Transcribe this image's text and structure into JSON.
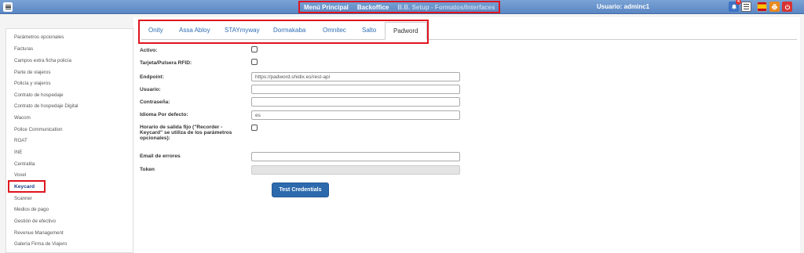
{
  "topbar": {
    "nav": [
      "Menú Principal",
      "Backoffice",
      "B.B. Setup - Formatos/Interfaces"
    ],
    "user": "Usuario: adminc1",
    "notification_count": "4",
    "icons": [
      "menu-icon",
      "bell-icon",
      "document-icon",
      "spain-flag-icon",
      "print-icon",
      "power-icon"
    ]
  },
  "sidebar": {
    "items": [
      "Parámetros opcionales",
      "Facturas",
      "Campos extra ficha policía",
      "Parte de viajeros",
      "Policía y viajeros",
      "Contrato de hospedaje",
      "Contrato de hospedaje Digital",
      "Wacom",
      "Police Communication",
      "ROAT",
      "INE",
      "Centralita",
      "Voxel",
      "Keycard",
      "Scanner",
      "Medios de pago",
      "Gestión de efectivo",
      "Revenue Management",
      "Galería Firma de Viajero"
    ],
    "active_item": "Keycard"
  },
  "tabs": [
    "Onity",
    "Assa Abloy",
    "STAYmyway",
    "Dormakaba",
    "Omnitec",
    "Salto",
    "Padword"
  ],
  "active_tab": "Padword",
  "form": {
    "activo_label": "Activo:",
    "tarjeta_label": "Tarjeta/Pulsera RFID:",
    "endpoint_label": "Endpoint:",
    "endpoint_value": "https://padword.shidix.es/rest-api",
    "usuario_label": "Usuario:",
    "usuario_value": "",
    "contrasena_label": "Contraseña:",
    "contrasena_value": "",
    "idioma_label": "Idioma Por defecto:",
    "idioma_value": "es",
    "horario_label": "Horario de salida fijo (\"Recorder - Keycard\" se utiliza de los parámetros opcionales):",
    "email_label": "Email de errores",
    "email_value": "",
    "token_label": "Token",
    "token_value": "",
    "test_button": "Test Credentials"
  },
  "colors": {
    "topbar": "#5b86c2",
    "highlight": "#e0141e",
    "link": "#2f6db3",
    "button": "#2d6aad",
    "active_sidebar": "#1b3e8c"
  }
}
